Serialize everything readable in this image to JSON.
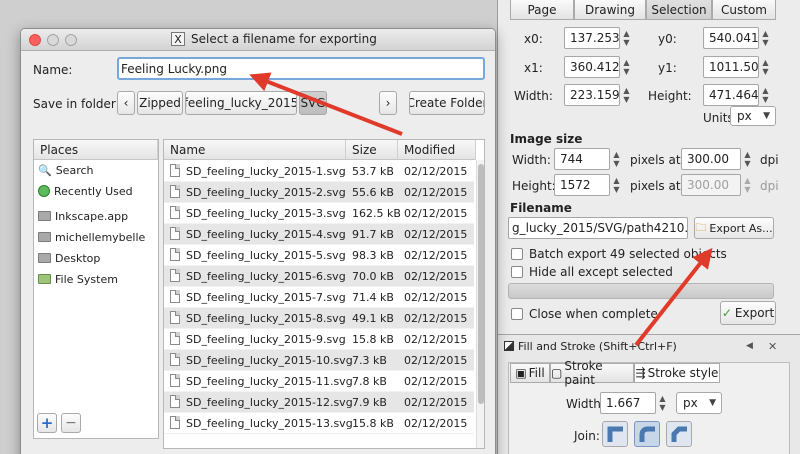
{
  "export_panel": {
    "tabs": [
      "Page",
      "Drawing",
      "Selection",
      "Custom"
    ],
    "active_tab": "Selection",
    "x0_label": "x0:",
    "x0": "137.253",
    "y0_label": "y0:",
    "y0": "540.041",
    "x1_label": "x1:",
    "x1": "360.412",
    "y1_label": "y1:",
    "y1": "1011.505",
    "width_label": "Width:",
    "width": "223.159",
    "height_label": "Height:",
    "height": "471.464",
    "units_label": "Units:",
    "units": "px",
    "image_size_heading": "Image size",
    "img_width_label": "Width:",
    "img_width": "744",
    "img_height_label": "Height:",
    "img_height": "1572",
    "pixels_at_1": "pixels at",
    "dpi_1": "300.00",
    "dpi_unit_1": "dpi",
    "pixels_at_2": "pixels at",
    "dpi_2": "300.00",
    "dpi_unit_2": "dpi",
    "filename_heading": "Filename",
    "filename": "g_lucky_2015/SVG/path4210.png",
    "export_as_label": "Export As...",
    "batch_label": "Batch export 49 selected objects",
    "hide_label": "Hide all except selected",
    "close_label": "Close when complete",
    "export_label": "Export"
  },
  "fill_stroke": {
    "title": "Fill and Stroke (Shift+Ctrl+F)",
    "tabs": [
      "Fill",
      "Stroke paint",
      "Stroke style"
    ],
    "width_label": "Width:",
    "width": "1.667",
    "unit": "px",
    "join_label": "Join:"
  },
  "dialog": {
    "title": "Select a filename for exporting",
    "name_label": "Name:",
    "name_value": "Feeling Lucky.png",
    "save_in_label": "Save in folder:",
    "breadcrumbs": [
      "Zipped",
      "feeling_lucky_2015",
      "SVG"
    ],
    "create_folder": "Create Folder",
    "places_header": "Places",
    "places": [
      {
        "label": "Search",
        "icon": "search-icon"
      },
      {
        "label": "Recently Used",
        "icon": "recent-icon"
      },
      {
        "label": "Inkscape.app",
        "icon": "folder-icon"
      },
      {
        "label": "michellemybelle",
        "icon": "folder-icon"
      },
      {
        "label": "Desktop",
        "icon": "folder-icon"
      },
      {
        "label": "File System",
        "icon": "drive-icon"
      }
    ],
    "columns": [
      "Name",
      "Size",
      "Modified"
    ],
    "files": [
      {
        "name": "SD_feeling_lucky_2015-1.svg",
        "size": "53.7 kB",
        "modified": "02/12/2015"
      },
      {
        "name": "SD_feeling_lucky_2015-2.svg",
        "size": "55.6 kB",
        "modified": "02/12/2015"
      },
      {
        "name": "SD_feeling_lucky_2015-3.svg",
        "size": "162.5 kB",
        "modified": "02/12/2015"
      },
      {
        "name": "SD_feeling_lucky_2015-4.svg",
        "size": "91.7 kB",
        "modified": "02/12/2015"
      },
      {
        "name": "SD_feeling_lucky_2015-5.svg",
        "size": "98.3 kB",
        "modified": "02/12/2015"
      },
      {
        "name": "SD_feeling_lucky_2015-6.svg",
        "size": "70.0 kB",
        "modified": "02/12/2015"
      },
      {
        "name": "SD_feeling_lucky_2015-7.svg",
        "size": "71.4 kB",
        "modified": "02/12/2015"
      },
      {
        "name": "SD_feeling_lucky_2015-8.svg",
        "size": "49.1 kB",
        "modified": "02/12/2015"
      },
      {
        "name": "SD_feeling_lucky_2015-9.svg",
        "size": "15.8 kB",
        "modified": "02/12/2015"
      },
      {
        "name": "SD_feeling_lucky_2015-10.svg",
        "size": "7.3 kB",
        "modified": "02/12/2015"
      },
      {
        "name": "SD_feeling_lucky_2015-11.svg",
        "size": "7.8 kB",
        "modified": "02/12/2015"
      },
      {
        "name": "SD_feeling_lucky_2015-12.svg",
        "size": "7.9 kB",
        "modified": "02/12/2015"
      },
      {
        "name": "SD_feeling_lucky_2015-13.svg",
        "size": "15.8 kB",
        "modified": "02/12/2015"
      }
    ]
  },
  "colors": {
    "arrow": "#e03a2a"
  }
}
